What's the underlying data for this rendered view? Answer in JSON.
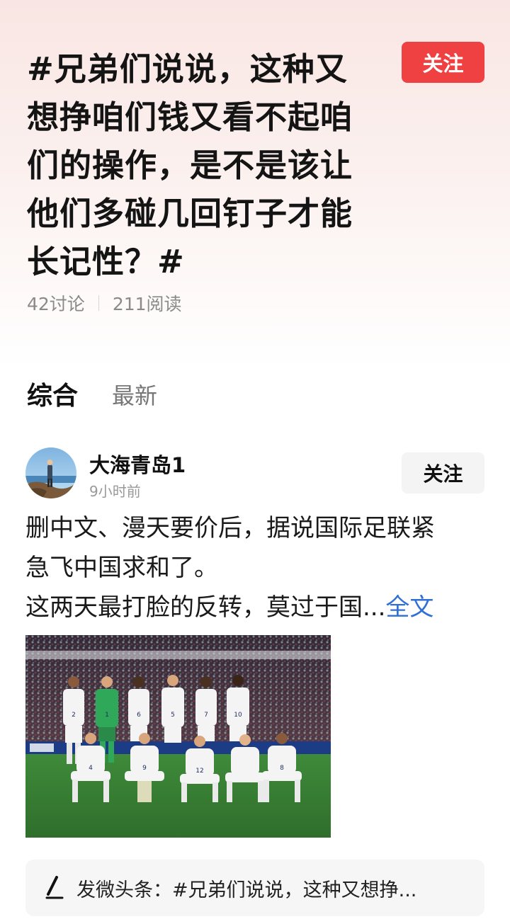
{
  "topic": {
    "title": "#兄弟们说说，这种又想挣咱们钱又看不起咱们的操作，是不是该让他们多碰几回钉子才能长记性？#",
    "follow_label": "关注",
    "discussions": "42讨论",
    "reads": "211阅读"
  },
  "tabs": {
    "active": "综合",
    "inactive": "最新"
  },
  "post": {
    "author": "大海青岛1",
    "time": "9小时前",
    "follow_label": "关注",
    "line1": "删中文、漫天要价后，据说国际足联紧",
    "line2": "急飞中国求和了。",
    "line3": "这两天最打脸的反转，莫过于国...",
    "read_more": "全文",
    "image": {
      "jersey_numbers_back": [
        "2",
        "1",
        "6",
        "5",
        "7",
        "10"
      ],
      "jersey_numbers_front": [
        "4",
        "9",
        "12",
        "8"
      ]
    }
  },
  "composer": {
    "icon": "pen-icon",
    "text": "发微头条：#兄弟们说说，这种又想挣..."
  },
  "colors": {
    "accent": "#f04142",
    "link": "#2f6fd6"
  }
}
